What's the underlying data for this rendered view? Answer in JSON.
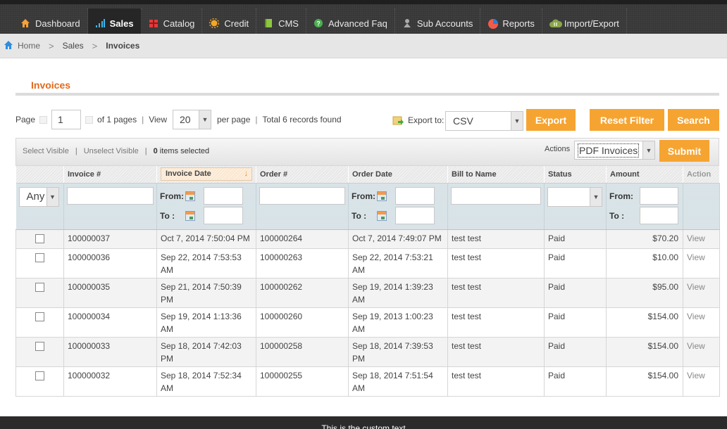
{
  "nav": {
    "items": [
      {
        "label": "Dashboard",
        "icon": "home-icon",
        "active": false
      },
      {
        "label": "Sales",
        "icon": "bar-chart-icon",
        "active": true
      },
      {
        "label": "Catalog",
        "icon": "gift-icon",
        "active": false
      },
      {
        "label": "Credit",
        "icon": "sun-icon",
        "active": false
      },
      {
        "label": "CMS",
        "icon": "book-icon",
        "active": false
      },
      {
        "label": "Advanced Faq",
        "icon": "question-icon",
        "active": false
      },
      {
        "label": "Sub Accounts",
        "icon": "user-icon",
        "active": false
      },
      {
        "label": "Reports",
        "icon": "pie-chart-icon",
        "active": false
      },
      {
        "label": "Import/Export",
        "icon": "cloud-transfer-icon",
        "active": false
      }
    ]
  },
  "breadcrumb": {
    "home": "Home",
    "sales": "Sales",
    "current": "Invoices",
    "separator": ">"
  },
  "page": {
    "title": "Invoices"
  },
  "pager": {
    "page_label": "Page",
    "page_value": "1",
    "of_pages": "of 1 pages",
    "view_label": "View",
    "per_page_value": "20",
    "per_page_label": "per page",
    "total": "Total 6 records found",
    "bar": "|"
  },
  "export": {
    "label": "Export to:",
    "format": "CSV",
    "export_button": "Export"
  },
  "buttons": {
    "reset_filter": "Reset Filter",
    "search": "Search",
    "submit": "Submit"
  },
  "massaction": {
    "select_visible": "Select Visible",
    "unselect_visible": "Unselect Visible",
    "selected_count": "0",
    "selected_suffix": " items selected",
    "actions_label": "Actions",
    "action_value": "PDF Invoices"
  },
  "columns": [
    "",
    "Invoice #",
    "Invoice Date",
    "Order #",
    "Order Date",
    "Bill to Name",
    "Status",
    "Amount",
    "Action"
  ],
  "sorted_arrow": "↓",
  "filters": {
    "any": "Any",
    "from": "From:",
    "to": "To :"
  },
  "rows": [
    {
      "invoice": "100000037",
      "invoice_date": "Oct 7, 2014 7:50:04 PM",
      "order": "100000264",
      "order_date": "Oct 7, 2014 7:49:07 PM",
      "bill_to": "test test",
      "status": "Paid",
      "amount": "$70.20",
      "action": "View"
    },
    {
      "invoice": "100000036",
      "invoice_date": "Sep 22, 2014 7:53:53 AM",
      "order": "100000263",
      "order_date": "Sep 22, 2014 7:53:21 AM",
      "bill_to": "test test",
      "status": "Paid",
      "amount": "$10.00",
      "action": "View"
    },
    {
      "invoice": "100000035",
      "invoice_date": "Sep 21, 2014 7:50:39 PM",
      "order": "100000262",
      "order_date": "Sep 19, 2014 1:39:23 AM",
      "bill_to": "test test",
      "status": "Paid",
      "amount": "$95.00",
      "action": "View"
    },
    {
      "invoice": "100000034",
      "invoice_date": "Sep 19, 2014 1:13:36 AM",
      "order": "100000260",
      "order_date": "Sep 19, 2013 1:00:23 AM",
      "bill_to": "test test",
      "status": "Paid",
      "amount": "$154.00",
      "action": "View"
    },
    {
      "invoice": "100000033",
      "invoice_date": "Sep 18, 2014 7:42:03 PM",
      "order": "100000258",
      "order_date": "Sep 18, 2014 7:39:53 PM",
      "bill_to": "test test",
      "status": "Paid",
      "amount": "$154.00",
      "action": "View"
    },
    {
      "invoice": "100000032",
      "invoice_date": "Sep 18, 2014 7:52:34 AM",
      "order": "100000255",
      "order_date": "Sep 18, 2014 7:51:54 AM",
      "bill_to": "test test",
      "status": "Paid",
      "amount": "$154.00",
      "action": "View"
    }
  ],
  "footer": {
    "text": "This is the custom text"
  },
  "colors": {
    "accent": "#f6a431",
    "title": "#e26a1c",
    "nav_bg": "#3a3a3a"
  }
}
